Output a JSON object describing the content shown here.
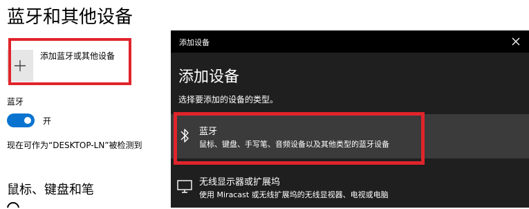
{
  "settings": {
    "page_title": "蓝牙和其他设备",
    "add_device_label": "添加蓝牙或其他设备",
    "bluetooth_label": "蓝牙",
    "toggle_state": "开",
    "discoverable_text": "现在可作为“DESKTOP-LN”被检测到",
    "section_mouse_title": "鼠标、键盘和笔"
  },
  "dialog": {
    "title": "添加设备",
    "heading": "添加设备",
    "subtitle": "选择要添加的设备的类型。",
    "options": [
      {
        "title": "蓝牙",
        "description": "鼠标、键盘、手写笔、音频设备以及其他类型的蓝牙设备",
        "icon": "bluetooth-icon"
      },
      {
        "title": "无线显示器或扩展坞",
        "description": "使用 Miracast 或无线扩展坞的无线显视器、电视或电脑",
        "icon": "monitor-icon"
      }
    ]
  },
  "colors": {
    "highlight": "#e0242b",
    "toggle_on": "#0a73d0",
    "dialog_bg": "#1f1f1f",
    "selected_option_bg": "#3b3b3b"
  }
}
